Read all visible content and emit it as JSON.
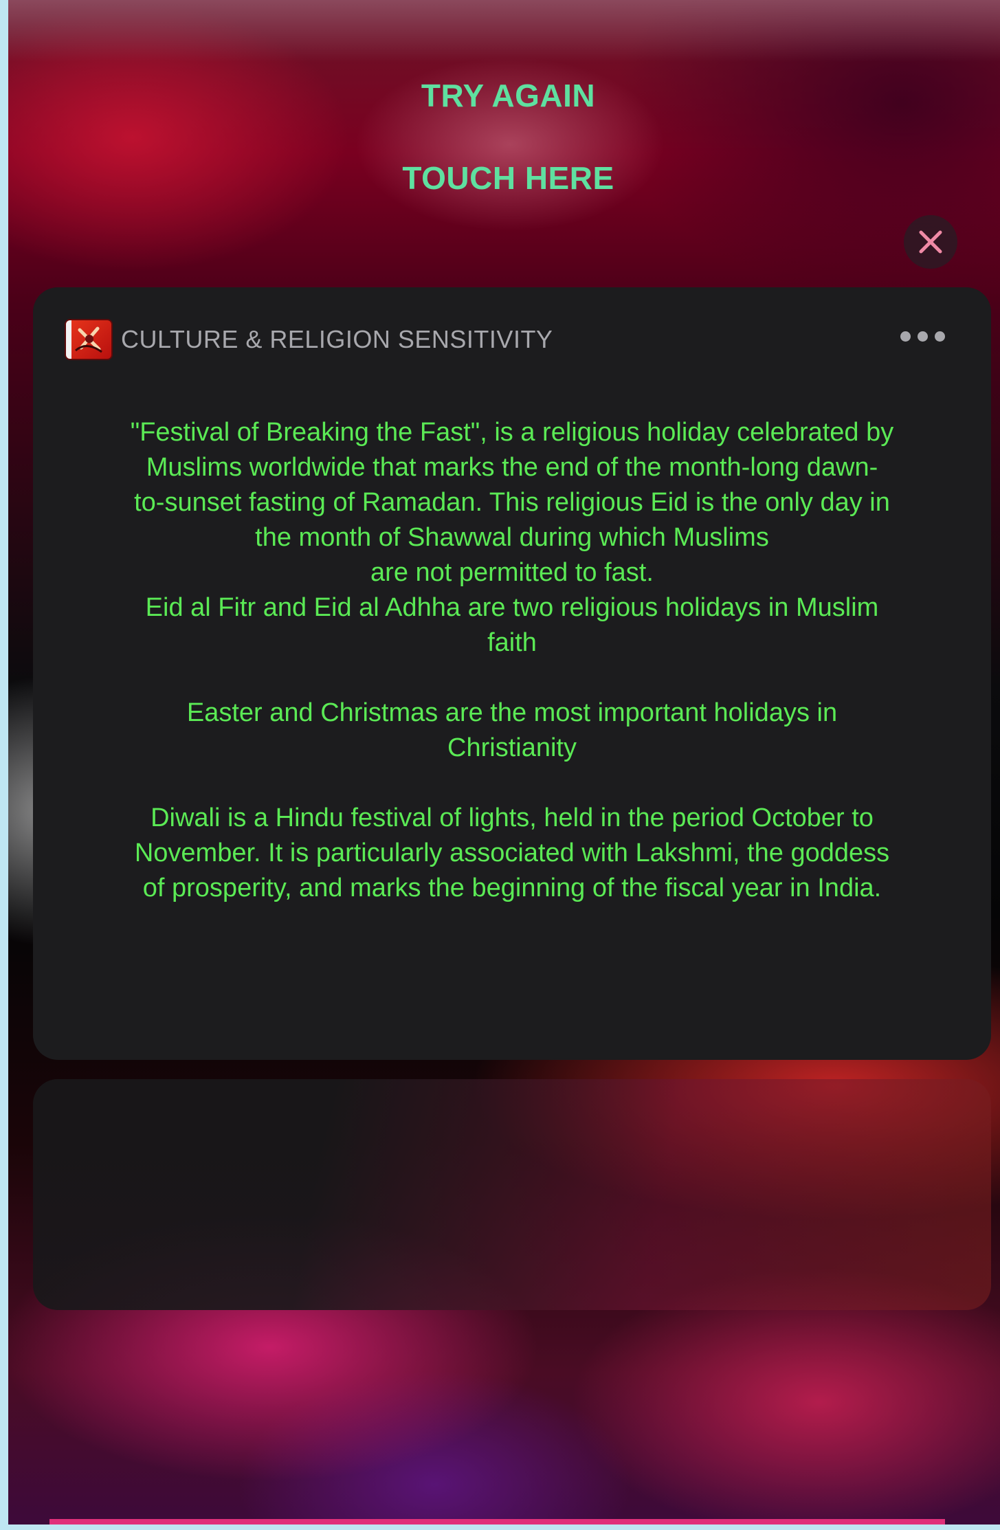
{
  "prompt": {
    "try_again": "TRY AGAIN",
    "touch_here": "TOUCH HERE"
  },
  "close_button": {
    "icon": "close-icon",
    "color": "#f08aa6"
  },
  "widget": {
    "app_icon": "culture-religion-app-icon",
    "title": "CULTURE & RELIGION SENSITIVITY",
    "more_icon": "ellipsis-icon",
    "paragraphs": [
      "\"Festival of Breaking the Fast\", is a religious holiday celebrated by\nMuslims worldwide that marks the end of the month-long dawn-\nto-sunset fasting of Ramadan. This religious Eid is the only day in\nthe month of Shawwal during which Muslims\nare not permitted to fast.\nEid al Fitr and Eid al Adhha are two religious holidays in Muslim\nfaith",
      "Easter and Christmas are the most important holidays in\nChristianity",
      "Diwali is a Hindu festival of lights, held in the period October to\nNovember. It is particularly associated with Lakshmi, the goddess\nof prosperity, and marks the beginning of the fiscal year in India."
    ]
  },
  "colors": {
    "accent_green": "#5fe0a0",
    "body_text_green": "#5bea55",
    "card_bg": "#1c1c1e",
    "title_gray": "#a8a8ad"
  }
}
